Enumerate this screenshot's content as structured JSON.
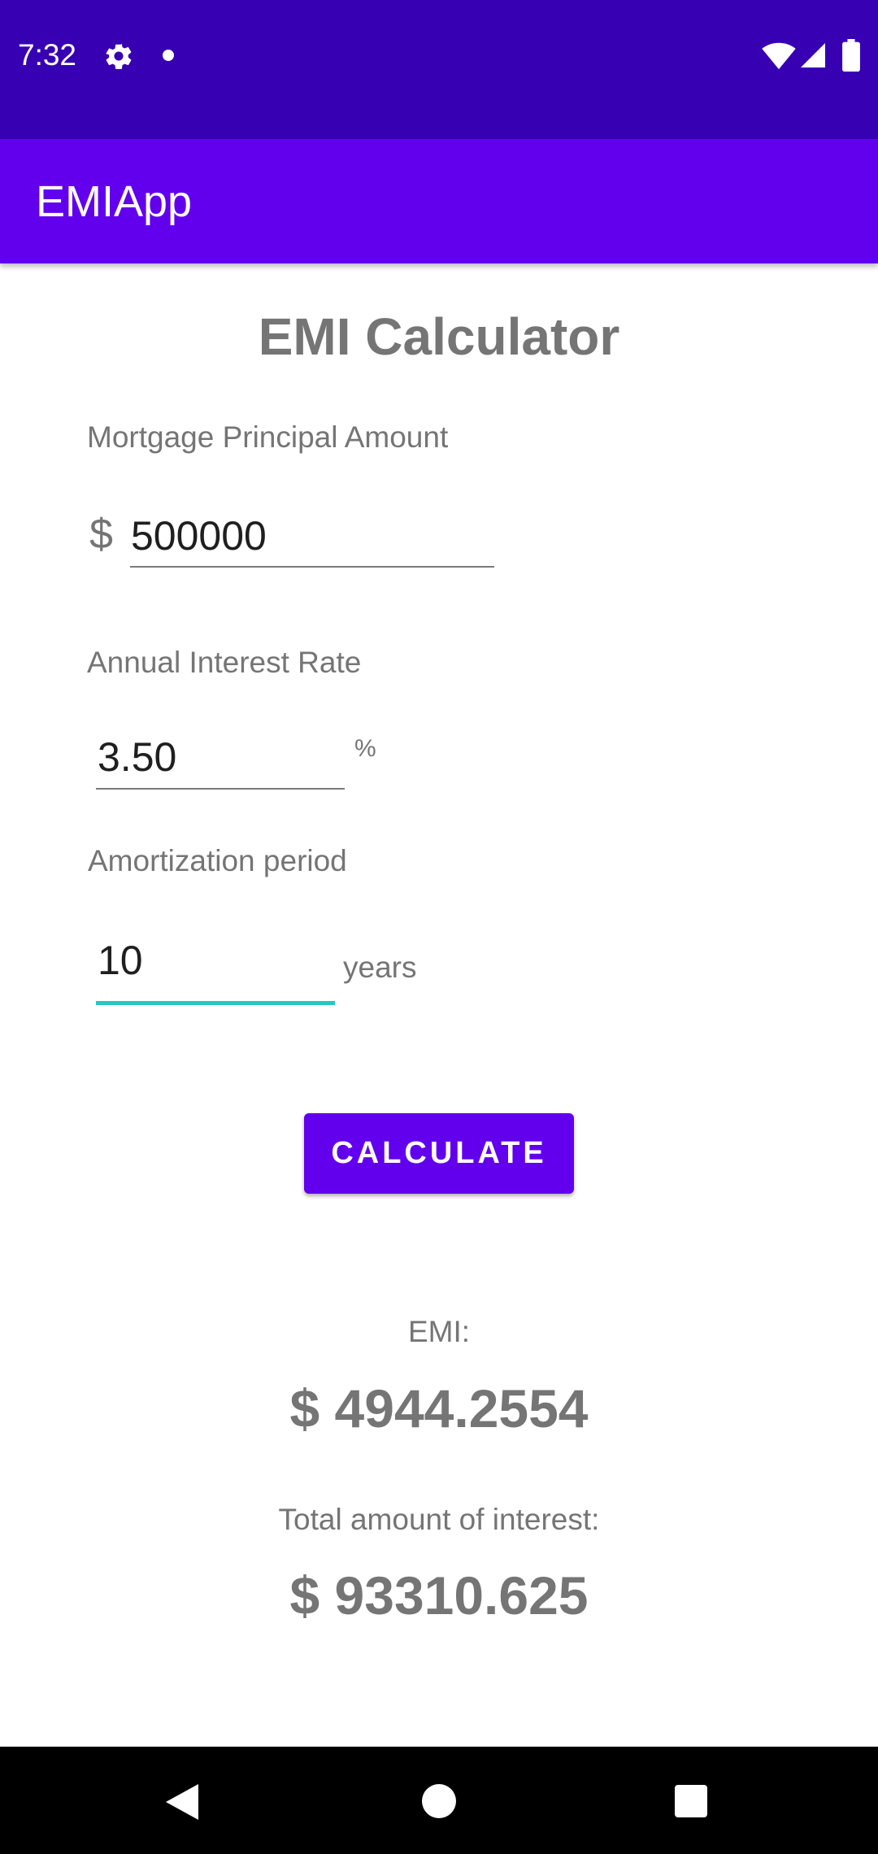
{
  "status_bar": {
    "time": "7:32",
    "icons": [
      "gear-icon",
      "notification-dot-icon",
      "wifi-icon",
      "signal-icon",
      "battery-icon"
    ]
  },
  "app_bar": {
    "title": "EMIApp"
  },
  "main": {
    "heading": "EMI Calculator",
    "principal": {
      "label": "Mortgage Principal Amount",
      "prefix": "$",
      "value": "500000"
    },
    "rate": {
      "label": "Annual Interest Rate",
      "value": "3.50",
      "suffix": "%"
    },
    "period": {
      "label": "Amortization period",
      "value": "10",
      "suffix": "years"
    },
    "calculate_label": "CALCULATE",
    "results": {
      "emi_label": "EMI:",
      "emi_value": "$ 4944.2554",
      "interest_label": "Total amount of interest:",
      "interest_value": "$ 93310.625"
    }
  },
  "nav_bar": {
    "icons": [
      "back-icon",
      "home-icon",
      "recents-icon"
    ]
  },
  "colors": {
    "status_bar": "#3700b3",
    "app_bar": "#6200ee",
    "accent": "#26c6c6",
    "text_secondary": "#757575"
  }
}
